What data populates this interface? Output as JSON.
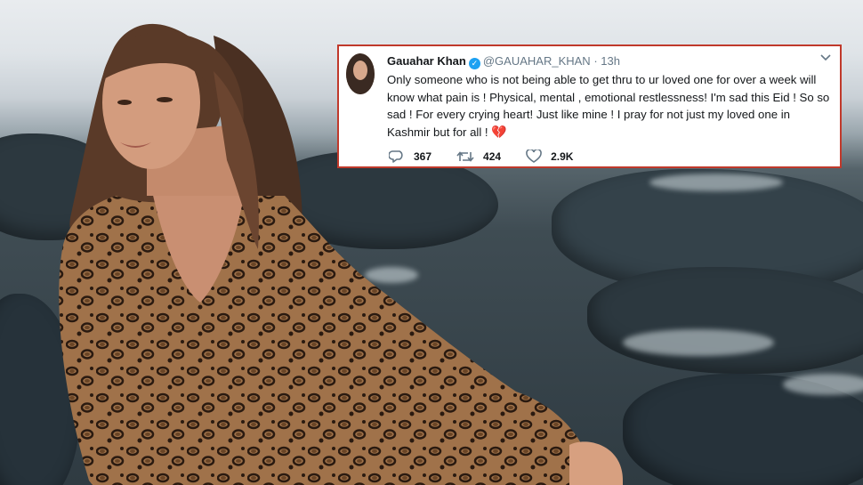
{
  "tweet": {
    "name": "Gauahar Khan",
    "handle": "@GAUAHAR_KHAN",
    "separator": "·",
    "time": "13h",
    "text": "Only someone who is not being able to get thru to ur loved one for over a week will know what pain is ! Physical, mental , emotional restlessness!  I'm sad this Eid ! So so sad ! For every crying heart! Just like mine ! I pray for not just my loved one in Kashmir but for all !",
    "emoji": "💔",
    "replies": "367",
    "retweets": "424",
    "likes": "2.9K"
  },
  "colors": {
    "border": "#c0392b",
    "verified": "#1da1f2",
    "muted": "#657786"
  },
  "icons": [
    "verified-icon",
    "chevron-down-icon",
    "reply-icon",
    "retweet-icon",
    "like-icon"
  ]
}
